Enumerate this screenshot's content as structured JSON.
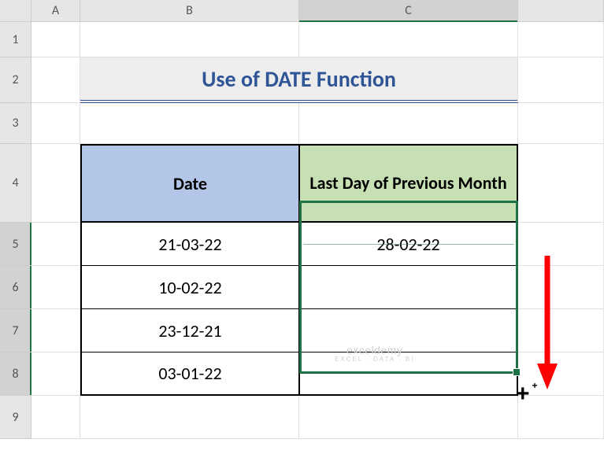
{
  "columns": {
    "A": "A",
    "B": "B",
    "C": "C"
  },
  "rows": {
    "1": "1",
    "2": "2",
    "3": "3",
    "4": "4",
    "5": "5",
    "6": "6",
    "7": "7",
    "8": "8",
    "9": "9"
  },
  "title": "Use of DATE Function",
  "headers": {
    "date": "Date",
    "last": "Last Day of Previous Month"
  },
  "data": {
    "b5": "21-03-22",
    "c5": "28-02-22",
    "b6": "10-02-22",
    "c6": "",
    "b7": "23-12-21",
    "c7": "",
    "b8": "03-01-22",
    "c8": ""
  },
  "watermark": {
    "line1": "exceldemy",
    "line2": "EXCEL · DATA · BI"
  },
  "active_cell": "C5",
  "selection_range": "C5:C8",
  "chart_data": {
    "type": "table",
    "title": "Use of DATE Function",
    "columns": [
      "Date",
      "Last Day of Previous Month"
    ],
    "rows": [
      [
        "21-03-22",
        "28-02-22"
      ],
      [
        "10-02-22",
        ""
      ],
      [
        "23-12-21",
        ""
      ],
      [
        "03-01-22",
        ""
      ]
    ]
  }
}
